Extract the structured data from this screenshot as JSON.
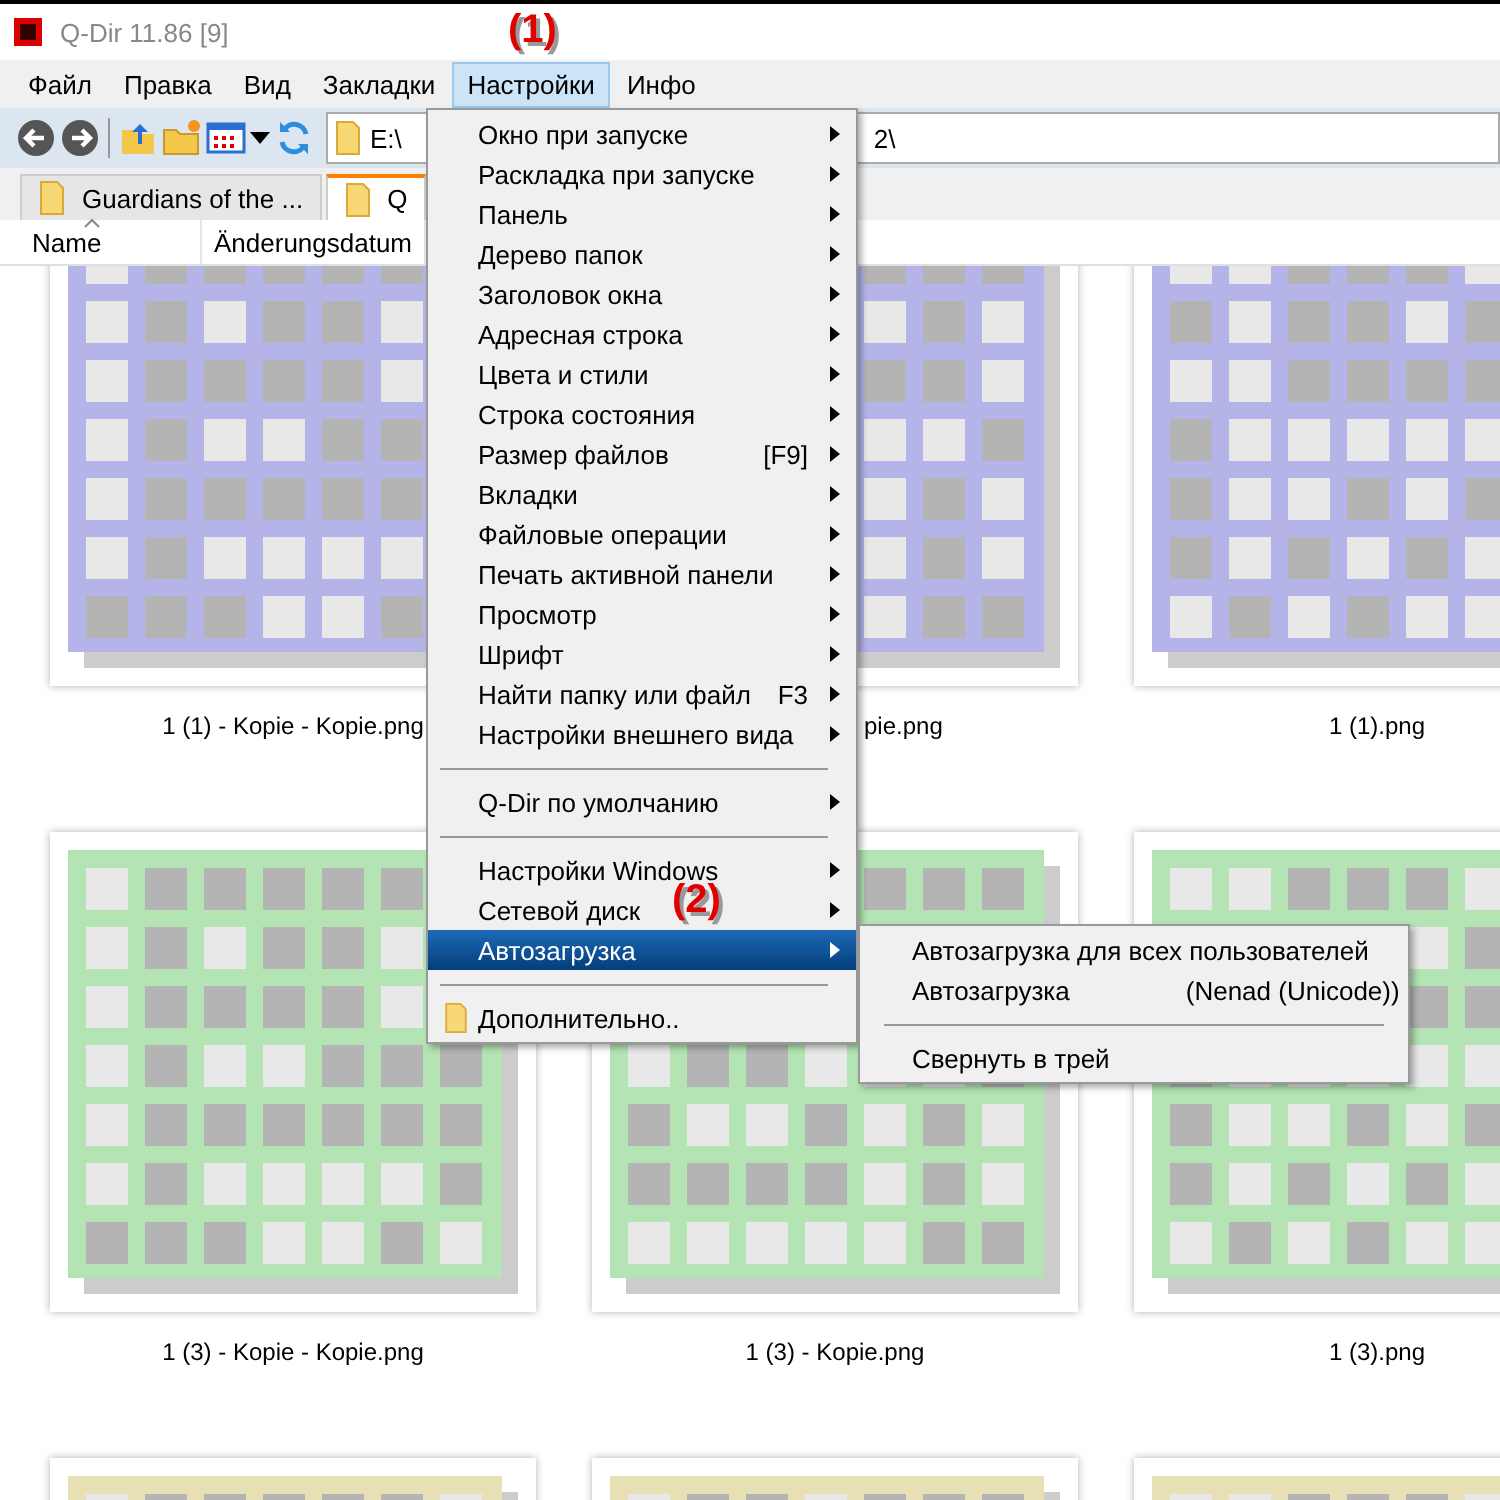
{
  "window": {
    "title": "Q-Dir 11.86 [9]"
  },
  "menu_bar": [
    {
      "label": "Файл",
      "selected": false
    },
    {
      "label": "Правка",
      "selected": false
    },
    {
      "label": "Вид",
      "selected": false
    },
    {
      "label": "Закладки",
      "selected": false
    },
    {
      "label": "Настройки",
      "selected": true,
      "annotation": "(1)"
    },
    {
      "label": "Инфо",
      "selected": false
    }
  ],
  "address_field": {
    "value_start": "E:\\",
    "value_end": "2\\"
  },
  "tabs": [
    {
      "label": "Guardians of the ...",
      "selected": false
    },
    {
      "label": "Q",
      "selected": true
    }
  ],
  "columns": [
    {
      "label": "Name",
      "sorted": true
    },
    {
      "label": "Änderungsdatum",
      "sorted": false
    }
  ],
  "thumbnails": [
    {
      "label": "1 (1) - Kopie - Kopie.png",
      "color": "#b4b4e8"
    },
    {
      "label": "pie.png",
      "color": "#b4b4e8"
    },
    {
      "label": "1 (1).png",
      "color": "#b4b4e8"
    },
    {
      "label": "1 (3) - Kopie - Kopie.png",
      "color": "#b4e4b4"
    },
    {
      "label": "1 (3) - Kopie.png",
      "color": "#b4e4b4"
    },
    {
      "label": "1 (3).png",
      "color": "#b4e4b4"
    },
    {
      "color": "#e6e0b4"
    },
    {
      "color": "#e6e0b4"
    },
    {
      "color": "#e6e0b4"
    }
  ],
  "dropdown_menu": {
    "items": [
      {
        "kind": "item",
        "label": "Окно при запуске",
        "submenu": true,
        "selected": false
      },
      {
        "kind": "item",
        "label": "Раскладка при запуске",
        "submenu": true,
        "selected": false
      },
      {
        "kind": "item",
        "label": "Панель",
        "submenu": true,
        "selected": false
      },
      {
        "kind": "item",
        "label": "Дерево папок",
        "submenu": true,
        "selected": false
      },
      {
        "kind": "item",
        "label": "Заголовок окна",
        "submenu": true,
        "selected": false
      },
      {
        "kind": "item",
        "label": "Адресная строка",
        "submenu": true,
        "selected": false
      },
      {
        "kind": "item",
        "label": "Цвета и стили",
        "submenu": true,
        "selected": false
      },
      {
        "kind": "item",
        "label": "Строка состояния",
        "submenu": true,
        "selected": false
      },
      {
        "kind": "item",
        "label": "Размер файлов",
        "shortcut": "[F9]",
        "submenu": true,
        "selected": false
      },
      {
        "kind": "item",
        "label": "Вкладки",
        "submenu": true,
        "selected": false
      },
      {
        "kind": "item",
        "label": "Файловые операции",
        "submenu": true,
        "selected": false
      },
      {
        "kind": "item",
        "label": "Печать активной панели",
        "submenu": true,
        "selected": false
      },
      {
        "kind": "item",
        "label": "Просмотр",
        "submenu": true,
        "selected": false
      },
      {
        "kind": "item",
        "label": "Шрифт",
        "submenu": true,
        "selected": false
      },
      {
        "kind": "item",
        "label": "Найти папку или файл",
        "shortcut": "F3",
        "submenu": true,
        "selected": false
      },
      {
        "kind": "item",
        "label": "Настройки внешнего вида",
        "submenu": true,
        "selected": false
      },
      {
        "kind": "separator"
      },
      {
        "kind": "item",
        "label": "Q-Dir по умолчанию",
        "submenu": true,
        "selected": false
      },
      {
        "kind": "separator"
      },
      {
        "kind": "item",
        "label": "Настройки Windows",
        "submenu": true,
        "selected": false
      },
      {
        "kind": "item",
        "label": "Сетевой диск",
        "submenu": true,
        "selected": false,
        "annotation": "(2)"
      },
      {
        "kind": "item",
        "label": "Автозагрузка",
        "submenu": true,
        "selected": true
      },
      {
        "kind": "separator"
      },
      {
        "kind": "folder_item",
        "label": "Дополнительно..",
        "submenu": false,
        "selected": false
      }
    ]
  },
  "submenu": {
    "items": [
      {
        "kind": "item",
        "label": "Автозагрузка для всех пользователей"
      },
      {
        "kind": "item",
        "label": "Автозагрузка",
        "detail": "(Nenad (Unicode))"
      },
      {
        "kind": "separator"
      },
      {
        "kind": "item",
        "label": "Свернуть в трей"
      }
    ]
  }
}
